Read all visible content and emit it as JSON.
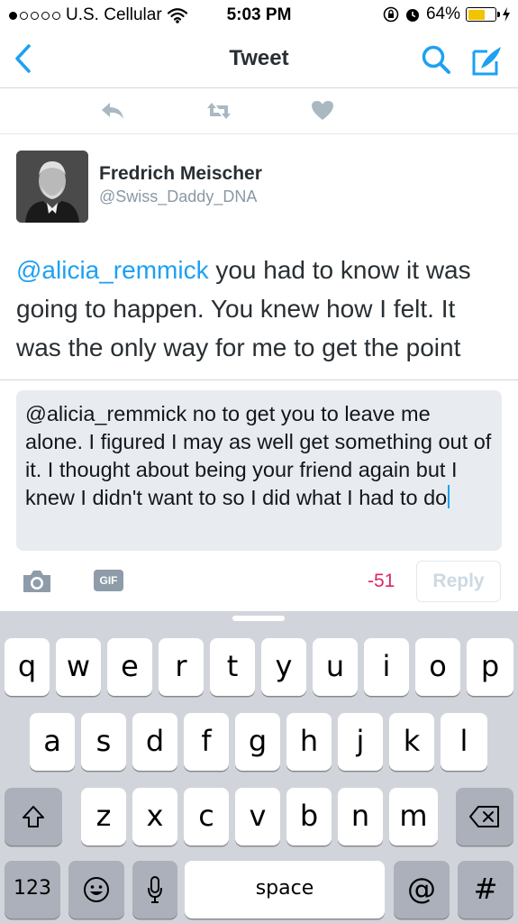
{
  "status_bar": {
    "carrier": "U.S. Cellular",
    "time": "5:03 PM",
    "battery": "64%",
    "battery_level": 0.64,
    "signal_bars_filled": 1,
    "signal_bars_total": 5
  },
  "nav": {
    "title": "Tweet",
    "icons": [
      "back-chevron-icon",
      "search-icon",
      "compose-icon"
    ],
    "accent_color": "#1da1f2"
  },
  "tweet_actions": {
    "icons": [
      "reply-icon",
      "retweet-icon",
      "like-icon"
    ]
  },
  "tweet": {
    "author_name": "Fredrich Meischer",
    "author_handle": "@Swiss_Daddy_DNA",
    "mention": "@alicia_remmick",
    "body": " you had to know it was going to happen. You knew how I felt. It was the only way for me to get the point across"
  },
  "composer": {
    "text": "@alicia_remmick no to get you to leave me alone. I figured I may as well get something out of it. I thought about being your friend again but I knew I didn't want to so I did what I had to do",
    "camera_icon": "camera-icon",
    "gif_label": "GIF",
    "char_count": "-51",
    "reply_label": "Reply",
    "count_color": "#e0245e"
  },
  "keyboard": {
    "row1": [
      "q",
      "w",
      "e",
      "r",
      "t",
      "y",
      "u",
      "i",
      "o",
      "p"
    ],
    "row2": [
      "a",
      "s",
      "d",
      "f",
      "g",
      "h",
      "j",
      "k",
      "l"
    ],
    "row3": [
      "z",
      "x",
      "c",
      "v",
      "b",
      "n",
      "m"
    ],
    "numbers_label": "123",
    "space_label": "space",
    "at_label": "@",
    "hash_label": "#",
    "special_icons": [
      "shift-icon",
      "delete-icon",
      "emoji-icon",
      "microphone-icon"
    ]
  }
}
